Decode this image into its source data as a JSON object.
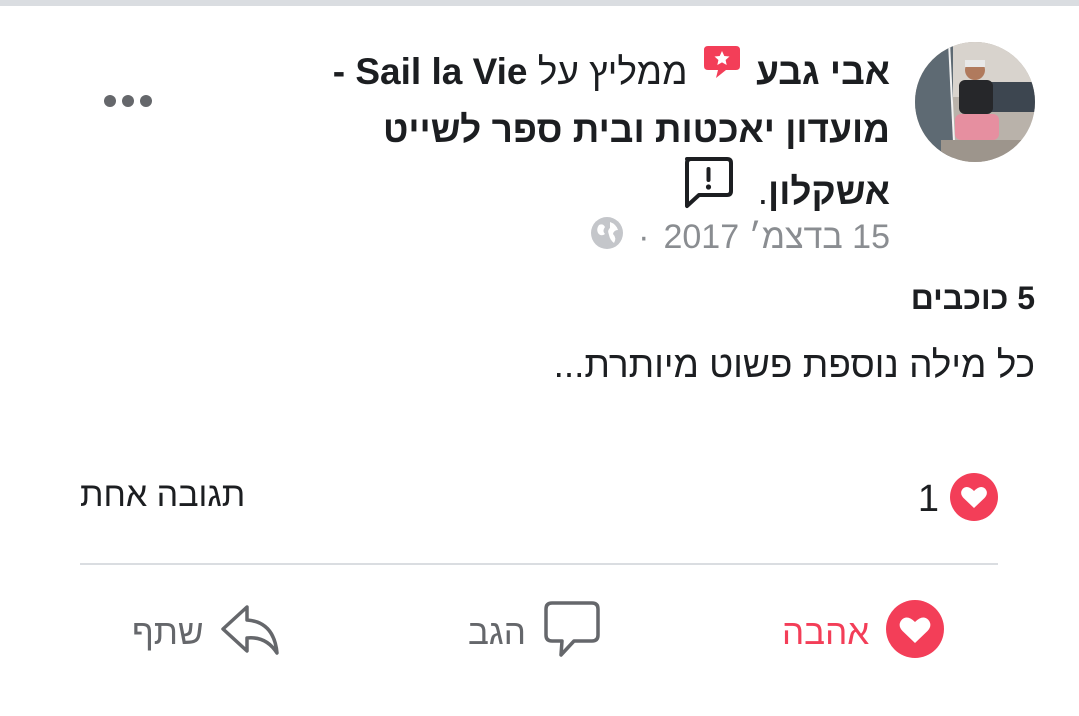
{
  "colors": {
    "love_red": "#f33e58",
    "text_dark": "#1c1e21",
    "text_gray": "#8a8d91",
    "icon_gray": "#65676b",
    "divider": "#dadde1"
  },
  "post": {
    "author_name": "אבי גבע",
    "recommends_text": "ממליץ על",
    "page_name": "Sail la Vie - מועדון יאכטות ובית ספר לשייט אשקלון",
    "trailing_period": ".",
    "date": "15 בדצמ׳ 2017",
    "separator": "·",
    "rating": "5 כוכבים",
    "review_text": "כל מילה נוספת פשוט מיותרת..."
  },
  "icons": {
    "recommend_badge": "recommend-star-icon",
    "report": "report-flag-icon",
    "privacy": "globe-icon",
    "more": "more-options-icon"
  },
  "stats": {
    "reactions_count": "1",
    "comments_count": "תגובה אחת"
  },
  "actions": {
    "love_label": "אהבה",
    "comment_label": "הגב",
    "share_label": "שתף"
  }
}
